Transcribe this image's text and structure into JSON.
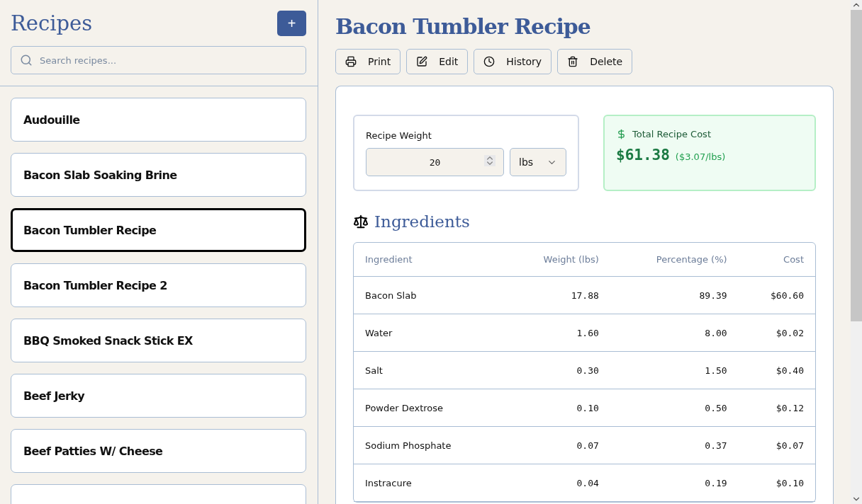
{
  "sidebar": {
    "title": "Recipes",
    "add_button": "+",
    "search": {
      "placeholder": "Search recipes..."
    },
    "items": [
      {
        "label": "Audouille",
        "selected": false
      },
      {
        "label": "Bacon Slab Soaking Brine",
        "selected": false
      },
      {
        "label": "Bacon Tumbler Recipe",
        "selected": true
      },
      {
        "label": "Bacon Tumbler Recipe 2",
        "selected": false
      },
      {
        "label": "BBQ Smoked Snack Stick EX",
        "selected": false
      },
      {
        "label": "Beef Jerky",
        "selected": false
      },
      {
        "label": "Beef Patties W/ Cheese",
        "selected": false
      }
    ]
  },
  "title": "Bacon Tumbler Recipe",
  "actions": [
    {
      "kind": "print",
      "label": "Print"
    },
    {
      "kind": "edit",
      "label": "Edit"
    },
    {
      "kind": "history",
      "label": "History"
    },
    {
      "kind": "delete",
      "label": "Delete"
    }
  ],
  "weight": {
    "label": "Recipe Weight",
    "value": "20",
    "unit": "lbs"
  },
  "cost": {
    "label": "Total Recipe Cost",
    "total": "$61.38",
    "per_unit": "($3.07/lbs)"
  },
  "ingredients": {
    "heading": "Ingredients",
    "columns": [
      "Ingredient",
      "Weight (lbs)",
      "Percentage (%)",
      "Cost"
    ],
    "rows": [
      [
        "Bacon Slab",
        "17.88",
        "89.39",
        "$60.60"
      ],
      [
        "Water",
        "1.60",
        "8.00",
        "$0.02"
      ],
      [
        "Salt",
        "0.30",
        "1.50",
        "$0.40"
      ],
      [
        "Powder Dextrose",
        "0.10",
        "0.50",
        "$0.12"
      ],
      [
        "Sodium Phosphate",
        "0.07",
        "0.37",
        "$0.07"
      ],
      [
        "Instracure",
        "0.04",
        "0.19",
        "$0.10"
      ]
    ]
  }
}
